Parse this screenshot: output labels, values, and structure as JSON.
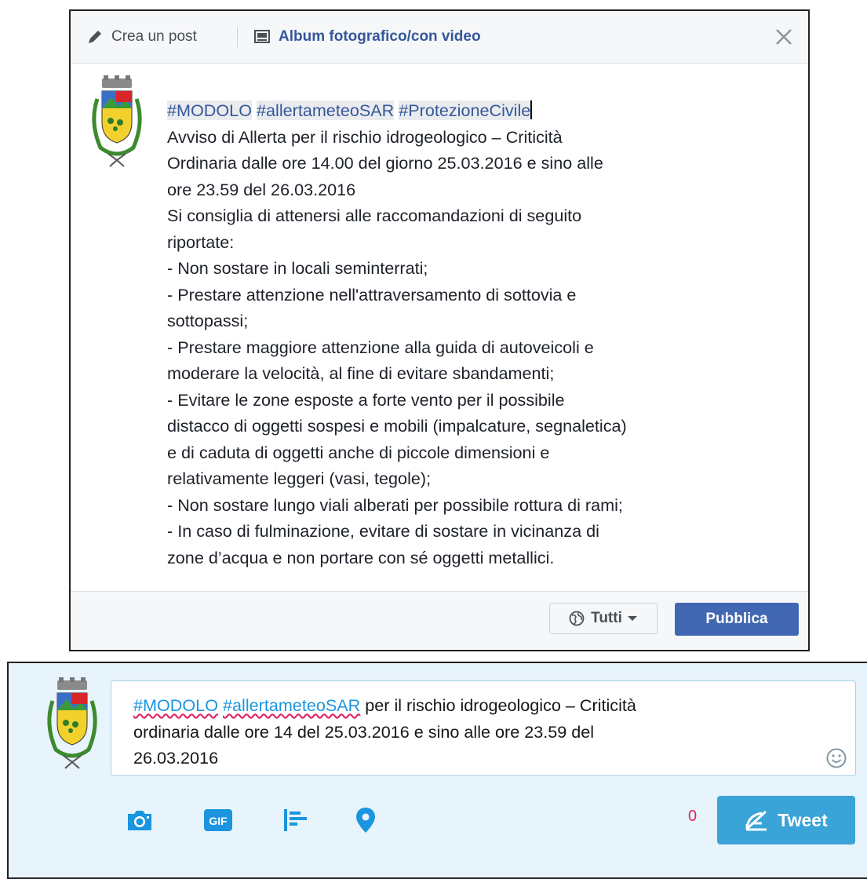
{
  "facebook": {
    "tab_create": "Crea un post",
    "tab_album": "Album fotografico/con video",
    "hashtags": [
      "#MODOLO",
      "#allertameteoSAR",
      "#ProtezioneCivile"
    ],
    "body_lines": [
      "Avviso di Allerta per il rischio idrogeologico – Criticità",
      "Ordinaria dalle ore 14.00 del giorno 25.03.2016 e sino alle",
      "ore 23.59 del 26.03.2016",
      "Si consiglia di attenersi alle raccomandazioni di seguito",
      "riportate:",
      "- Non sostare in locali seminterrati;",
      "- Prestare attenzione nell'attraversamento di sottovia e",
      "sottopassi;",
      "- Prestare maggiore attenzione alla guida di autoveicoli e",
      "moderare la velocità, al fine di evitare sbandamenti;",
      "- Evitare le zone esposte a forte vento per il possibile",
      "distacco di oggetti sospesi e mobili (impalcature, segnaletica)",
      "e di caduta di oggetti anche di piccole dimensioni e",
      "relativamente leggeri (vasi, tegole);",
      "- Non sostare lungo viali alberati per possibile rottura di rami;",
      "- In caso di fulminazione, evitare di sostare in vicinanza di",
      "zone d’acqua e non portare con sé oggetti metallici."
    ],
    "audience_label": "Tutti",
    "publish_label": "Pubblica"
  },
  "twitter": {
    "hashtag1": "#MODOLO",
    "hashtag2": "#allertameteoSAR",
    "line1_rest": " per il rischio idrogeologico – Criticità",
    "line2": "ordinaria dalle ore 14 del 25.03.2016 e sino alle ore 23.59 del",
    "line3": "26.03.2016",
    "char_count": "0",
    "tweet_label": "Tweet"
  },
  "colors": {
    "fb_blue": "#4267b2",
    "fb_link": "#365899",
    "tw_blue": "#1b95e0",
    "tw_button": "#3aa3d8",
    "tw_counter": "#e0245e"
  },
  "icons": [
    "pencil-icon",
    "album-icon",
    "close-icon",
    "globe-icon",
    "caret-down-icon",
    "emoji-icon",
    "camera-icon",
    "gif-icon",
    "poll-icon",
    "location-icon",
    "feather-icon",
    "crest-logo"
  ]
}
